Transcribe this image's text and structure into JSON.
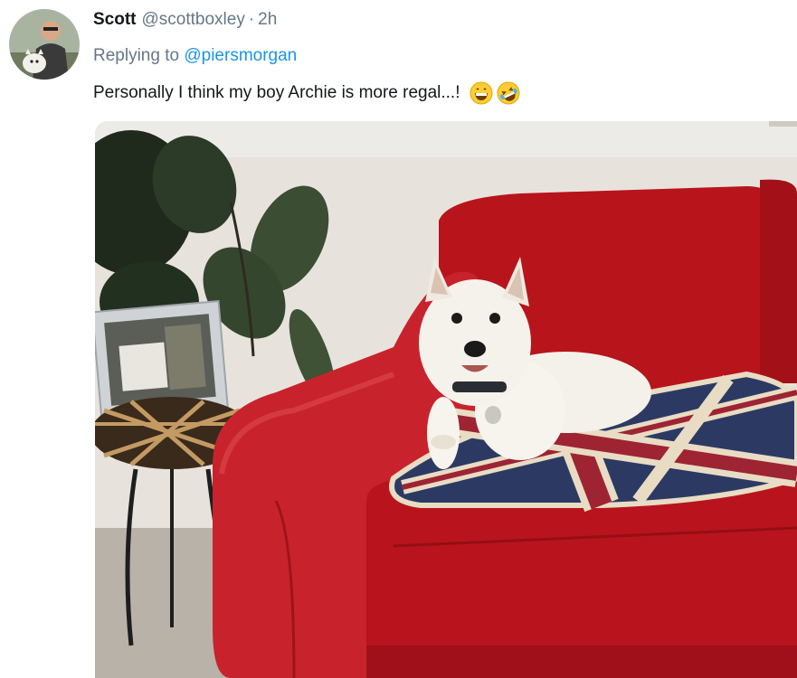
{
  "tweet": {
    "author_name": "Scott",
    "author_handle": "@scottboxley",
    "separator": "·",
    "time_ago": "2h",
    "replying_prefix": "Replying to",
    "replying_to": "@piersmorgan",
    "text": "Personally I think my boy Archie is more regal...!",
    "emojis": [
      "grinning-face-icon",
      "rolling-on-floor-laughing-icon"
    ]
  },
  "colors": {
    "name": "#14171a",
    "secondary": "#657786",
    "link": "#1b95e0",
    "sofa_red": "#c8232c",
    "flag_navy": "#2c3a63"
  }
}
